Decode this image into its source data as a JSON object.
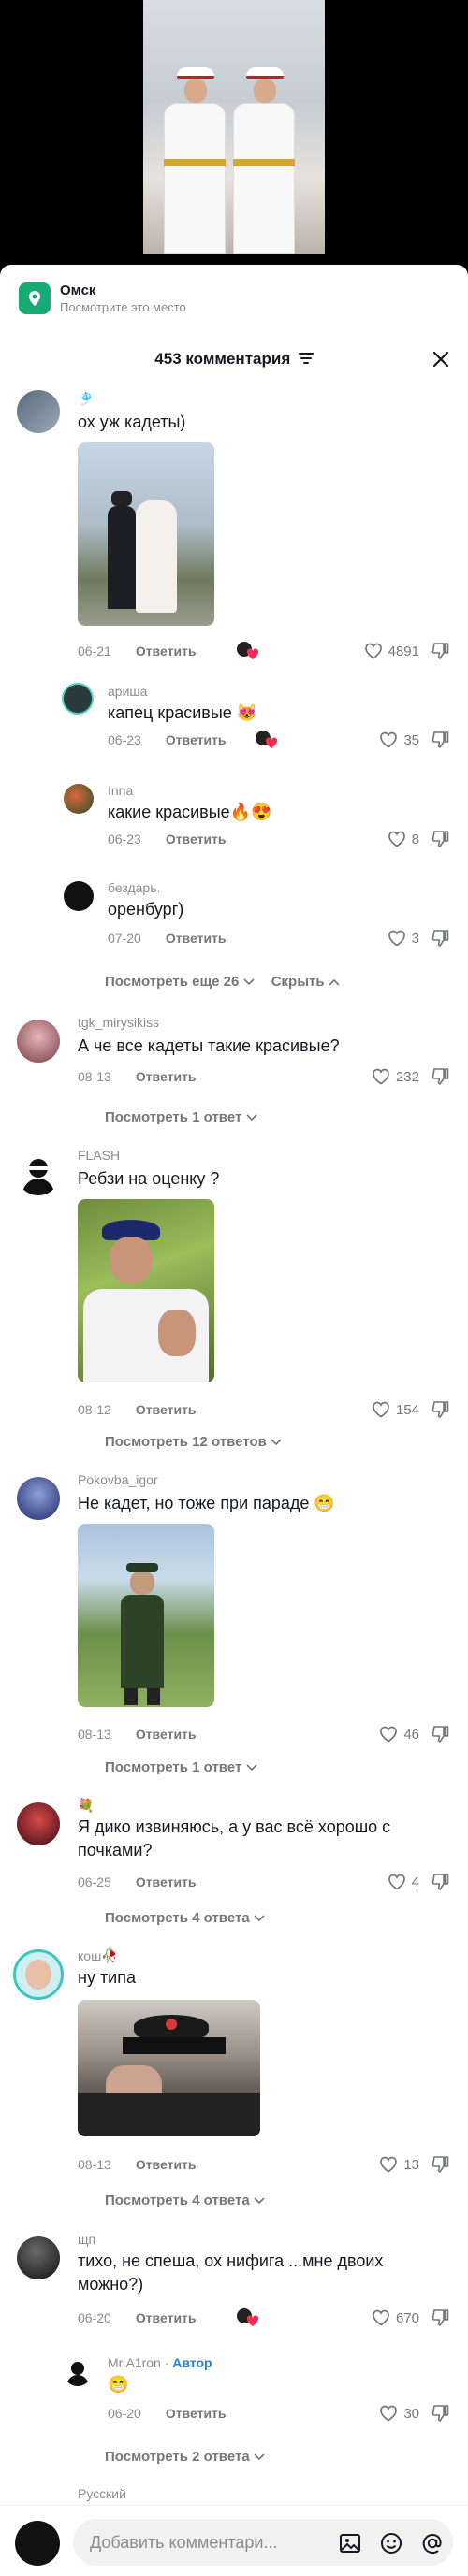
{
  "place": {
    "name": "Омск",
    "subtitle": "Посмотрите это место"
  },
  "header": {
    "count_label": "453 комментария"
  },
  "comments": [
    {
      "user": "🎐",
      "text": "ох уж кадеты)",
      "date": "06-21",
      "reply": "Ответить",
      "likes": "4891",
      "has_author_like": true
    },
    {
      "user": "ариша",
      "text": "капец красивые 😻",
      "date": "06-23",
      "reply": "Ответить",
      "likes": "35",
      "has_author_like": true
    },
    {
      "user": "Inna",
      "text": "какие красивые🔥😍",
      "date": "06-23",
      "reply": "Ответить",
      "likes": "8"
    },
    {
      "user": "бездарь.",
      "text": "оренбург)",
      "date": "07-20",
      "reply": "Ответить",
      "likes": "3"
    },
    {
      "user": "tgk_mirysikiss",
      "text": "А че все кадеты такие красивые?",
      "date": "08-13",
      "reply": "Ответить",
      "likes": "232"
    },
    {
      "user": "FLASH",
      "text": "Ребзи на оценку ?",
      "date": "08-12",
      "reply": "Ответить",
      "likes": "154"
    },
    {
      "user": "Pokovba_igor",
      "text": "Не кадет, но тоже при параде 😁",
      "date": "08-13",
      "reply": "Ответить",
      "likes": "46"
    },
    {
      "user": "💐",
      "text": "Я дико извиняюсь, а у вас всё хорошо с почками?",
      "date": "06-25",
      "reply": "Ответить",
      "likes": "4"
    },
    {
      "user": "кош🥀",
      "text": "ну типа",
      "date": "08-13",
      "reply": "Ответить",
      "likes": "13"
    },
    {
      "user": "щп",
      "text": "тихо, не спеша, ох нифига ...мне двоих можно?)",
      "date": "06-20",
      "reply": "Ответить",
      "likes": "670",
      "has_author_like": true
    },
    {
      "user": "Mr A1ron",
      "author_tag": "Автор",
      "text": "😁",
      "date": "06-20",
      "reply": "Ответить",
      "likes": "30"
    },
    {
      "user": "Русский"
    }
  ],
  "more_links": {
    "m1": "Посмотреть еще 26",
    "m1_hide": "Скрыть",
    "m2": "Посмотреть 1 ответ",
    "m3": "Посмотреть 12 ответов",
    "m4": "Посмотреть 1 ответ",
    "m5": "Посмотреть 4 ответа",
    "m6": "Посмотреть 4 ответа",
    "m7": "Посмотреть 2 ответа"
  },
  "bottom": {
    "placeholder": "Добавить комментари..."
  },
  "icons": [
    "location-pin-icon",
    "filter-icon",
    "close-icon",
    "heart-icon",
    "dislike-icon",
    "chevron-down-icon",
    "chevron-up-icon",
    "image-icon",
    "emoji-icon",
    "mention-icon"
  ],
  "colors": {
    "accent_green": "#19a974",
    "author_blue": "#2a7fd4",
    "text_gray": "#8a8b91",
    "liked_red": "#fe2c55"
  }
}
